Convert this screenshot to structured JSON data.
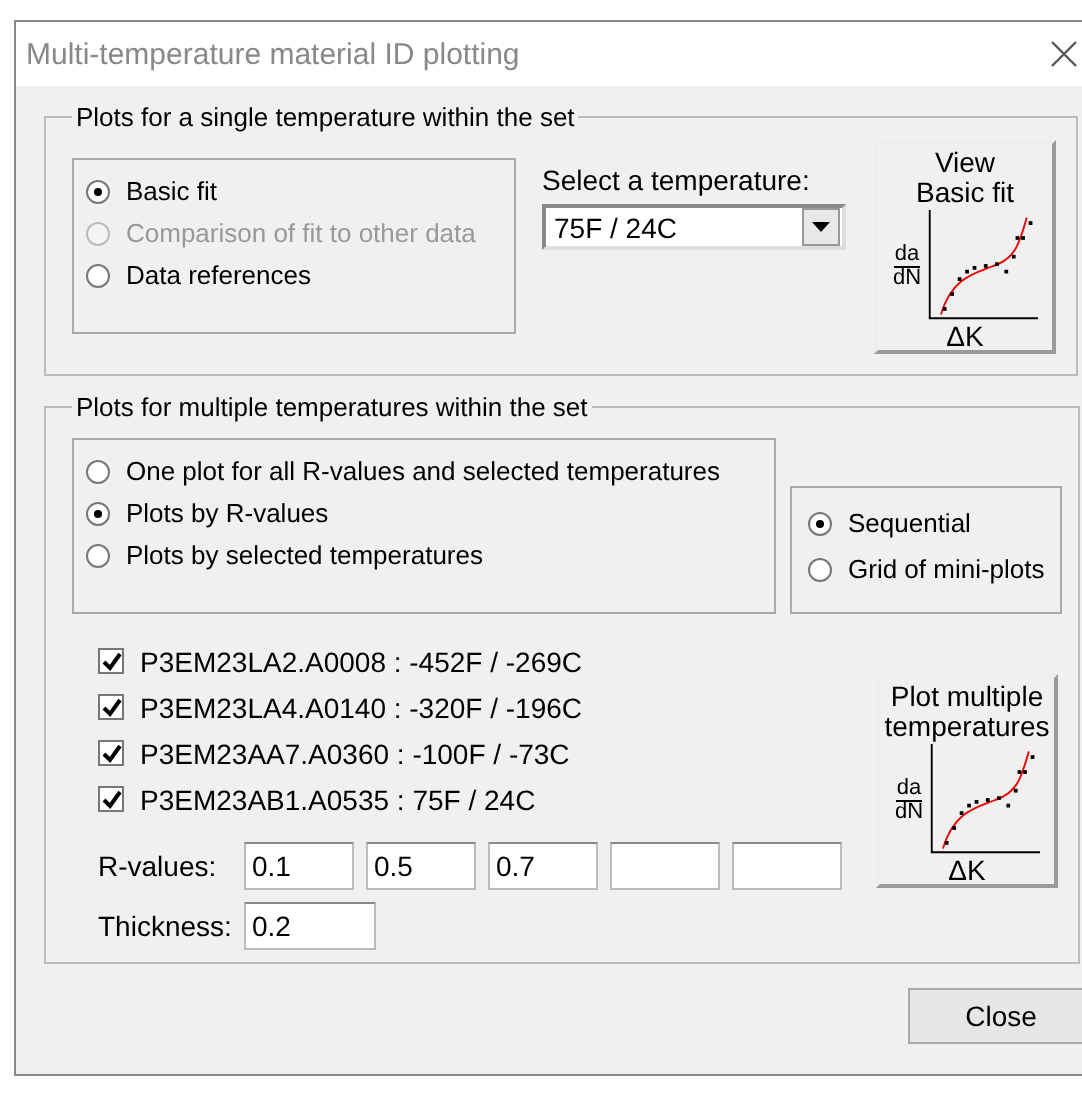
{
  "window": {
    "title": "Multi-temperature material ID plotting"
  },
  "single": {
    "title": "Plots for a single temperature within the set",
    "options": [
      {
        "label": "Basic fit",
        "selected": true,
        "disabled": false
      },
      {
        "label": "Comparison of fit to other data",
        "selected": false,
        "disabled": true
      },
      {
        "label": "Data references",
        "selected": false,
        "disabled": false
      }
    ],
    "select_label": "Select a temperature:",
    "select_value": "75F / 24C",
    "button": {
      "lines": [
        "View",
        "Basic fit"
      ],
      "y_num": "da",
      "y_den": "dN",
      "x_label": "ΔK"
    }
  },
  "multiple": {
    "title": "Plots for multiple temperatures within the set",
    "plot_modes": [
      {
        "label": "One plot for all R-values and selected temperatures",
        "selected": false
      },
      {
        "label": "Plots by R-values",
        "selected": true
      },
      {
        "label": "Plots by selected temperatures",
        "selected": false
      }
    ],
    "layouts": [
      {
        "label": "Sequential",
        "selected": true
      },
      {
        "label": "Grid of mini-plots",
        "selected": false
      }
    ],
    "temperatures": [
      {
        "label": "P3EM23LA2.A0008 : -452F / -269C",
        "checked": true
      },
      {
        "label": "P3EM23LA4.A0140 : -320F / -196C",
        "checked": true
      },
      {
        "label": "P3EM23AA7.A0360 : -100F / -73C",
        "checked": true
      },
      {
        "label": "P3EM23AB1.A0535 : 75F / 24C",
        "checked": true
      }
    ],
    "r_values": {
      "label": "R-values:",
      "fields": [
        {
          "kind": "filled",
          "value": "0.1"
        },
        {
          "kind": "filled",
          "value": "0.5"
        },
        {
          "kind": "filled",
          "value": "0.7"
        },
        {
          "kind": "empty"
        },
        {
          "kind": "empty"
        }
      ]
    },
    "thickness": {
      "label": "Thickness:",
      "value": "0.2"
    },
    "button": {
      "lines": [
        "Plot multiple",
        "temperatures"
      ],
      "y_num": "da",
      "y_den": "dN",
      "x_label": "ΔK"
    }
  },
  "close_button": "Close"
}
